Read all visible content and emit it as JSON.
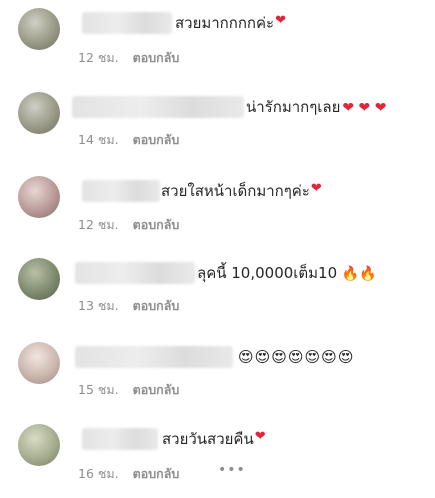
{
  "comments": [
    {
      "text": "สวยมากกกกค่ะ",
      "emoji": "❤",
      "time": "12 ชม.",
      "reply": "ตอบกลับ"
    },
    {
      "text": "น่ารักมากๆเลย",
      "emoji": "❤ ❤ ❤",
      "time": "14 ชม.",
      "reply": "ตอบกลับ"
    },
    {
      "text": "สวยใสหน้าเด็กมากๆค่ะ",
      "emoji": "❤",
      "time": "12 ชม.",
      "reply": "ตอบกลับ"
    },
    {
      "text": "ลุคนี้ 10,0000เต็ม10",
      "emoji": "🔥🔥",
      "time": "13 ชม.",
      "reply": "ตอบกลับ"
    },
    {
      "text": "",
      "emoji": "😍😍😍😍😍😍😍",
      "time": "15 ชม.",
      "reply": "ตอบกลับ"
    },
    {
      "text": "สวยวันสวยคืน",
      "emoji": "❤",
      "time": "16 ชม.",
      "reply": "ตอบกลับ",
      "more": "•••"
    }
  ]
}
